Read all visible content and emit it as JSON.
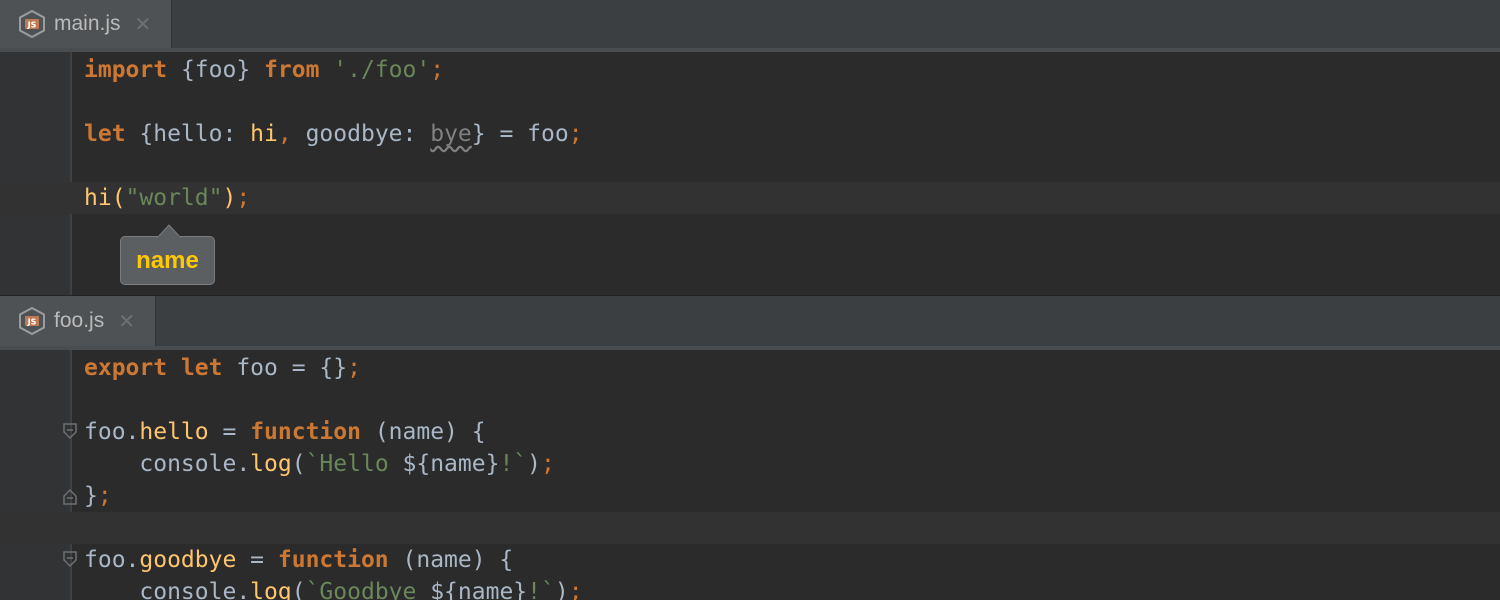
{
  "tabs": {
    "main": {
      "label": "main.js",
      "icon": "javascript-file-icon",
      "close": "✕"
    },
    "foo": {
      "label": "foo.js",
      "icon": "javascript-file-icon",
      "close": "✕"
    }
  },
  "icon_text": "JS",
  "tooltip": {
    "label": "name"
  },
  "main_code": {
    "l1": {
      "import": "import",
      "brace": " {foo} ",
      "from": "from",
      "str": " './foo'",
      "semi": ";"
    },
    "l2": {
      "let": "let",
      "a": " {hello: ",
      "hi": "hi",
      "comma": ",",
      "b": " goodbye: ",
      "bye": "bye",
      "c": "} = foo",
      "semi": ";"
    },
    "l3": {
      "a": "hi(",
      "str": "\"world\"",
      "b": ")",
      "semi": ";"
    }
  },
  "foo_code": {
    "l1": {
      "export": "export",
      "let": " let",
      "a": " foo = {}",
      "semi": ";"
    },
    "l2": {
      "a": "foo.",
      "fn": "hello",
      "b": " = ",
      "kw": "function",
      "c": " (name) {"
    },
    "l3": {
      "a": "    console.",
      "fn": "log",
      "b": "(",
      "str": "`Hello ",
      "c": "${name}",
      "str2": "!`",
      "d": ")",
      "semi": ";"
    },
    "l4": {
      "a": "}",
      "semi": ";"
    },
    "l5": {
      "a": "foo.",
      "fn": "goodbye",
      "b": " = ",
      "kw": "function",
      "c": " (name) {"
    },
    "l6": {
      "a": "    console.",
      "fn": "log",
      "b": "(",
      "str": "`Goodbye ",
      "c": "${name}",
      "str2": "!`",
      "d": ")",
      "semi": ";"
    }
  },
  "colors": {
    "keyword": "#cc7832",
    "string": "#6a8759",
    "function": "#ffc66d",
    "text": "#a9b7c6",
    "tooltip_text": "#ffc800"
  }
}
